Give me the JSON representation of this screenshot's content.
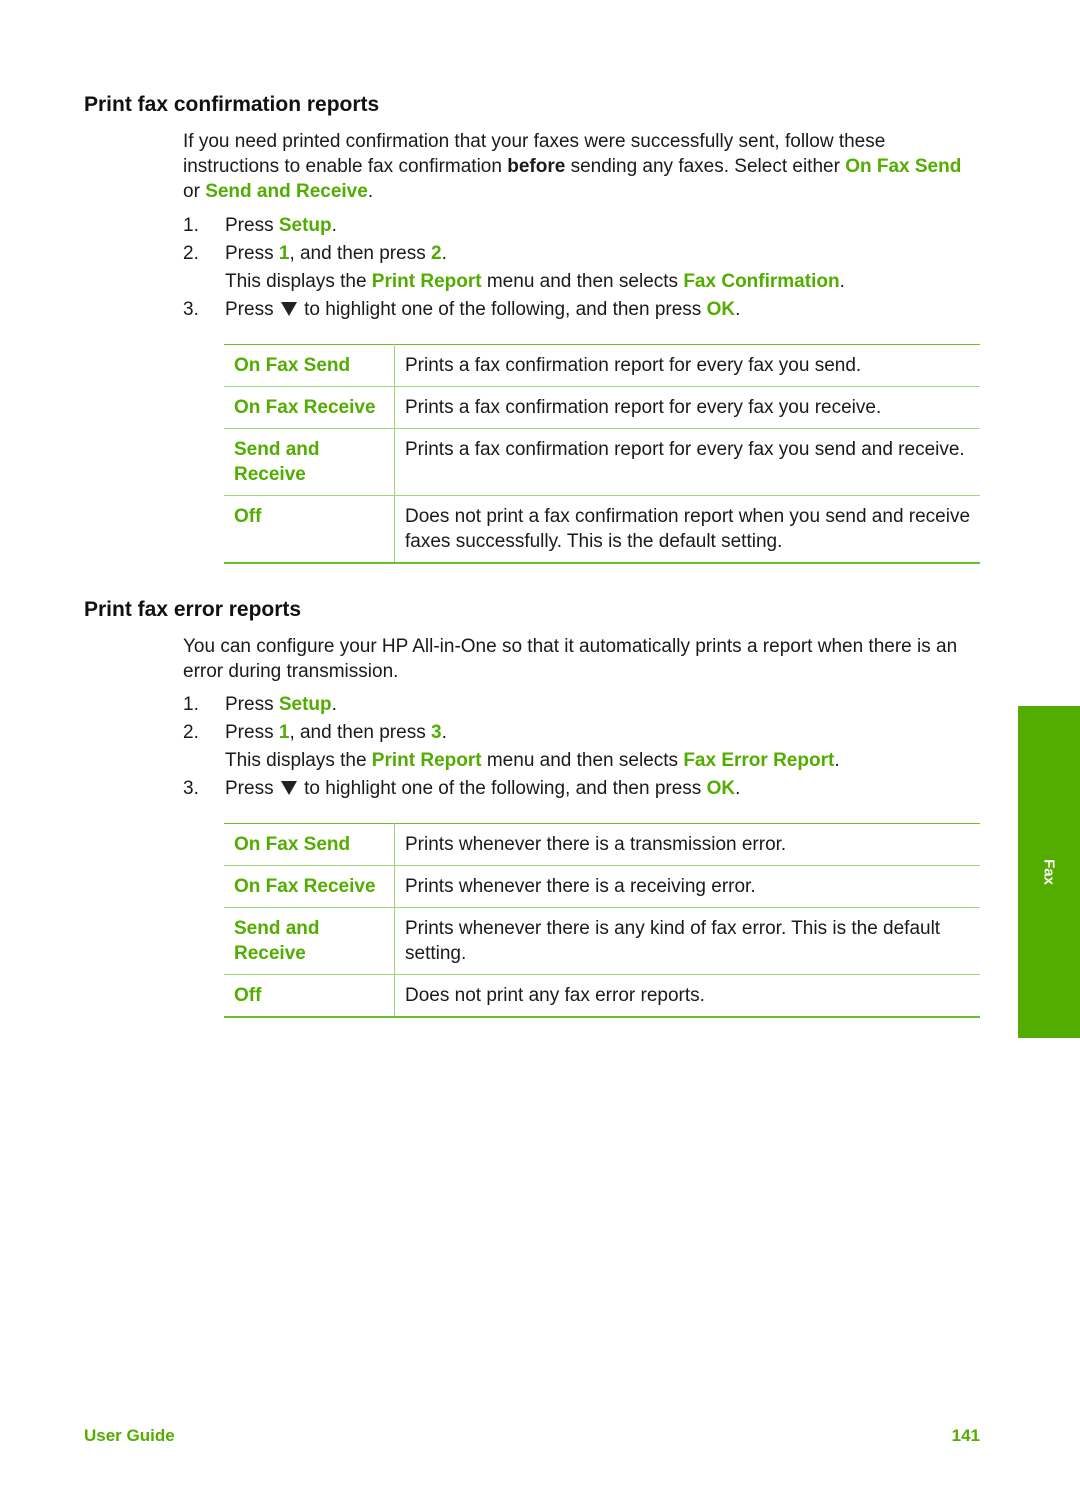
{
  "section1": {
    "heading": "Print fax confirmation reports",
    "intro": {
      "t1": "If you need printed confirmation that your faxes were successfully sent, follow these instructions to enable fax confirmation ",
      "bold": "before",
      "t2": " sending any faxes. Select either ",
      "opt1": "On Fax Send",
      "t3": " or ",
      "opt2": "Send and Receive",
      "t4": "."
    },
    "steps": [
      {
        "num": "1.",
        "pre": "Press ",
        "key": "Setup",
        "post": "."
      },
      {
        "num": "2.",
        "pre": "Press ",
        "key1": "1",
        "mid": ", and then press ",
        "key2": "2",
        "post": ".",
        "note_pre": "This displays the ",
        "menu": "Print Report",
        "note_mid": " menu and then selects ",
        "item": "Fax Confirmation",
        "note_post": "."
      },
      {
        "num": "3.",
        "pre": "Press ",
        "icon": "down-arrow",
        "mid": " to highlight one of the following, and then press ",
        "key": "OK",
        "post": "."
      }
    ],
    "table": [
      {
        "option": "On Fax Send",
        "description": "Prints a fax confirmation report for every fax you send."
      },
      {
        "option": "On Fax Receive",
        "description": "Prints a fax confirmation report for every fax you receive."
      },
      {
        "option": "Send and Receive",
        "description": "Prints a fax confirmation report for every fax you send and receive."
      },
      {
        "option": "Off",
        "description": "Does not print a fax confirmation report when you send and receive faxes successfully. This is the default setting."
      }
    ]
  },
  "section2": {
    "heading": "Print fax error reports",
    "intro": "You can configure your HP All-in-One so that it automatically prints a report when there is an error during transmission.",
    "steps": [
      {
        "num": "1.",
        "pre": "Press ",
        "key": "Setup",
        "post": "."
      },
      {
        "num": "2.",
        "pre": "Press ",
        "key1": "1",
        "mid": ", and then press ",
        "key2": "3",
        "post": ".",
        "note_pre": "This displays the ",
        "menu": "Print Report",
        "note_mid": " menu and then selects ",
        "item": "Fax Error Report",
        "note_post": "."
      },
      {
        "num": "3.",
        "pre": "Press ",
        "icon": "down-arrow",
        "mid": " to highlight one of the following, and then press ",
        "key": "OK",
        "post": "."
      }
    ],
    "table": [
      {
        "option": "On Fax Send",
        "description": "Prints whenever there is a transmission error."
      },
      {
        "option": "On Fax Receive",
        "description": "Prints whenever there is a receiving error."
      },
      {
        "option": "Send and Receive",
        "description": "Prints whenever there is any kind of fax error. This is the default setting."
      },
      {
        "option": "Off",
        "description": "Does not print any fax error reports."
      }
    ]
  },
  "side_tab": {
    "label": "Fax",
    "color": "#52ad00"
  },
  "footer": {
    "left": "User Guide",
    "page": "141"
  },
  "colors": {
    "accent": "#52ad00",
    "text": "#1a1a1a"
  }
}
